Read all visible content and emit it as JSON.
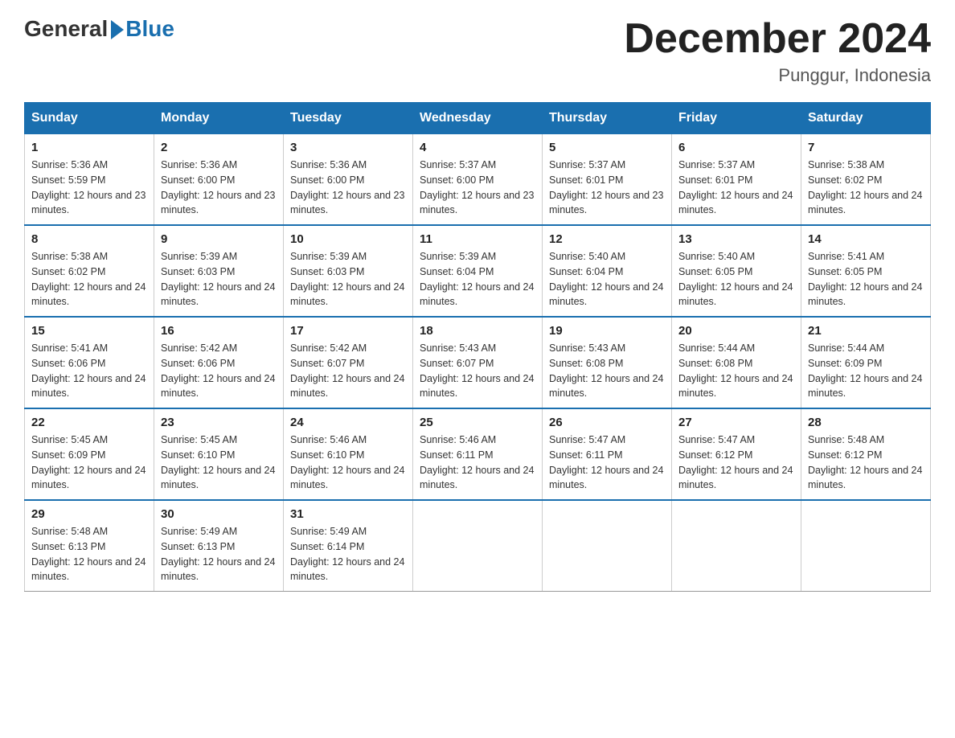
{
  "header": {
    "logo_general": "General",
    "logo_blue": "Blue",
    "month_title": "December 2024",
    "location": "Punggur, Indonesia"
  },
  "days_of_week": [
    "Sunday",
    "Monday",
    "Tuesday",
    "Wednesday",
    "Thursday",
    "Friday",
    "Saturday"
  ],
  "weeks": [
    [
      {
        "day": "1",
        "sunrise": "5:36 AM",
        "sunset": "5:59 PM",
        "daylight": "12 hours and 23 minutes."
      },
      {
        "day": "2",
        "sunrise": "5:36 AM",
        "sunset": "6:00 PM",
        "daylight": "12 hours and 23 minutes."
      },
      {
        "day": "3",
        "sunrise": "5:36 AM",
        "sunset": "6:00 PM",
        "daylight": "12 hours and 23 minutes."
      },
      {
        "day": "4",
        "sunrise": "5:37 AM",
        "sunset": "6:00 PM",
        "daylight": "12 hours and 23 minutes."
      },
      {
        "day": "5",
        "sunrise": "5:37 AM",
        "sunset": "6:01 PM",
        "daylight": "12 hours and 23 minutes."
      },
      {
        "day": "6",
        "sunrise": "5:37 AM",
        "sunset": "6:01 PM",
        "daylight": "12 hours and 24 minutes."
      },
      {
        "day": "7",
        "sunrise": "5:38 AM",
        "sunset": "6:02 PM",
        "daylight": "12 hours and 24 minutes."
      }
    ],
    [
      {
        "day": "8",
        "sunrise": "5:38 AM",
        "sunset": "6:02 PM",
        "daylight": "12 hours and 24 minutes."
      },
      {
        "day": "9",
        "sunrise": "5:39 AM",
        "sunset": "6:03 PM",
        "daylight": "12 hours and 24 minutes."
      },
      {
        "day": "10",
        "sunrise": "5:39 AM",
        "sunset": "6:03 PM",
        "daylight": "12 hours and 24 minutes."
      },
      {
        "day": "11",
        "sunrise": "5:39 AM",
        "sunset": "6:04 PM",
        "daylight": "12 hours and 24 minutes."
      },
      {
        "day": "12",
        "sunrise": "5:40 AM",
        "sunset": "6:04 PM",
        "daylight": "12 hours and 24 minutes."
      },
      {
        "day": "13",
        "sunrise": "5:40 AM",
        "sunset": "6:05 PM",
        "daylight": "12 hours and 24 minutes."
      },
      {
        "day": "14",
        "sunrise": "5:41 AM",
        "sunset": "6:05 PM",
        "daylight": "12 hours and 24 minutes."
      }
    ],
    [
      {
        "day": "15",
        "sunrise": "5:41 AM",
        "sunset": "6:06 PM",
        "daylight": "12 hours and 24 minutes."
      },
      {
        "day": "16",
        "sunrise": "5:42 AM",
        "sunset": "6:06 PM",
        "daylight": "12 hours and 24 minutes."
      },
      {
        "day": "17",
        "sunrise": "5:42 AM",
        "sunset": "6:07 PM",
        "daylight": "12 hours and 24 minutes."
      },
      {
        "day": "18",
        "sunrise": "5:43 AM",
        "sunset": "6:07 PM",
        "daylight": "12 hours and 24 minutes."
      },
      {
        "day": "19",
        "sunrise": "5:43 AM",
        "sunset": "6:08 PM",
        "daylight": "12 hours and 24 minutes."
      },
      {
        "day": "20",
        "sunrise": "5:44 AM",
        "sunset": "6:08 PM",
        "daylight": "12 hours and 24 minutes."
      },
      {
        "day": "21",
        "sunrise": "5:44 AM",
        "sunset": "6:09 PM",
        "daylight": "12 hours and 24 minutes."
      }
    ],
    [
      {
        "day": "22",
        "sunrise": "5:45 AM",
        "sunset": "6:09 PM",
        "daylight": "12 hours and 24 minutes."
      },
      {
        "day": "23",
        "sunrise": "5:45 AM",
        "sunset": "6:10 PM",
        "daylight": "12 hours and 24 minutes."
      },
      {
        "day": "24",
        "sunrise": "5:46 AM",
        "sunset": "6:10 PM",
        "daylight": "12 hours and 24 minutes."
      },
      {
        "day": "25",
        "sunrise": "5:46 AM",
        "sunset": "6:11 PM",
        "daylight": "12 hours and 24 minutes."
      },
      {
        "day": "26",
        "sunrise": "5:47 AM",
        "sunset": "6:11 PM",
        "daylight": "12 hours and 24 minutes."
      },
      {
        "day": "27",
        "sunrise": "5:47 AM",
        "sunset": "6:12 PM",
        "daylight": "12 hours and 24 minutes."
      },
      {
        "day": "28",
        "sunrise": "5:48 AM",
        "sunset": "6:12 PM",
        "daylight": "12 hours and 24 minutes."
      }
    ],
    [
      {
        "day": "29",
        "sunrise": "5:48 AM",
        "sunset": "6:13 PM",
        "daylight": "12 hours and 24 minutes."
      },
      {
        "day": "30",
        "sunrise": "5:49 AM",
        "sunset": "6:13 PM",
        "daylight": "12 hours and 24 minutes."
      },
      {
        "day": "31",
        "sunrise": "5:49 AM",
        "sunset": "6:14 PM",
        "daylight": "12 hours and 24 minutes."
      },
      null,
      null,
      null,
      null
    ]
  ]
}
